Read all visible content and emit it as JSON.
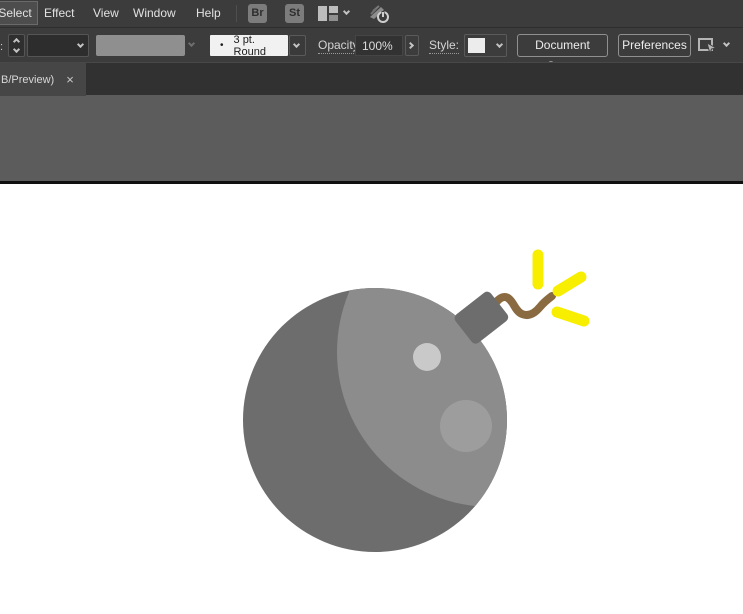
{
  "menu_bar": {
    "items": [
      {
        "label": "Select"
      },
      {
        "label": "Effect"
      },
      {
        "label": "View"
      },
      {
        "label": "Window"
      },
      {
        "label": "Help"
      }
    ],
    "bridge_badge": "Br",
    "stock_badge": "St"
  },
  "control_bar": {
    "clipped_fragment": ":",
    "brush_bullet": "•",
    "brush_name": "3 pt. Round",
    "opacity_label": "Opacity:",
    "opacity_value": "100%",
    "style_label": "Style:",
    "document_setup_button": "Document Setup",
    "preferences_button": "Preferences"
  },
  "tab_bar": {
    "active_tab_title": "B/Preview)",
    "close_glyph": "×"
  },
  "artwork": {
    "description": "flat bomb icon with lit fuse",
    "background": "#ffffff",
    "bomb": {
      "body_color": "#6d6d6d",
      "highlight_color": "#8c8c8c",
      "shine_small_color": "#c9c9c9",
      "shine_large_color": "#9d9d9d",
      "cap_color": "#6d6d6d",
      "fuse_color": "#8a6a40",
      "spark_color": "#f7ee00"
    }
  }
}
